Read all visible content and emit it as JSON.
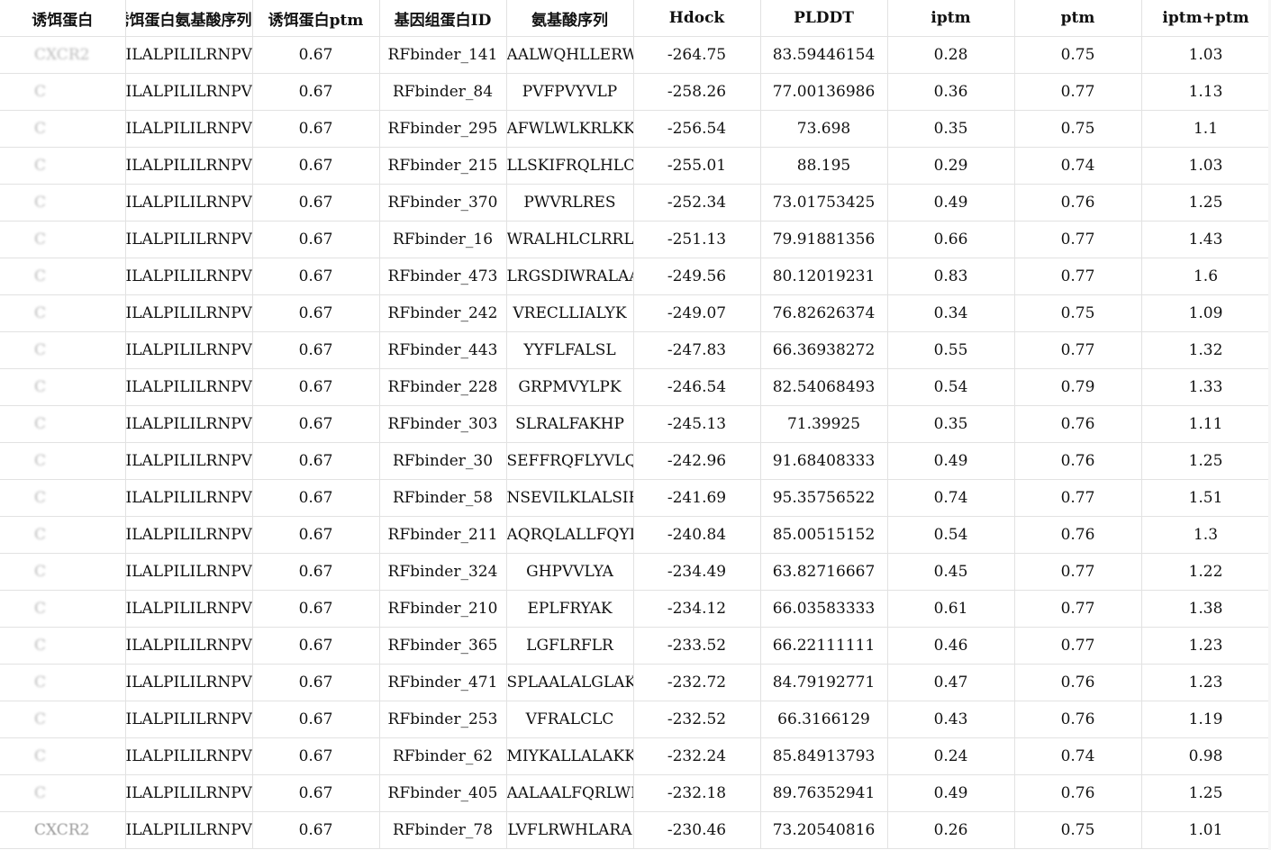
{
  "headers": [
    "诱饵蛋白",
    "诱饵蛋白氨基酸序列",
    "诱饵蛋白ptm",
    "基因组蛋白ID",
    "氨基酸序列",
    "Hdock",
    "PLDDT",
    "iptm",
    "ptm",
    "iptm+ptm"
  ],
  "rows": [
    [
      "CXCR2",
      "ILALPILILRNPVK",
      "0.67",
      "RFbinder_141",
      "AALWQHLLERW",
      "-264.75",
      "83.59446154",
      "0.28",
      "0.75",
      "1.03"
    ],
    [
      "C",
      "ILALPILILRNPVK",
      "0.67",
      "RFbinder_84",
      "PVFPVYVLP",
      "-258.26",
      "77.00136986",
      "0.36",
      "0.77",
      "1.13"
    ],
    [
      "C",
      "ILALPILILRNPVK",
      "0.67",
      "RFbinder_295",
      "AFWLWLKRLKKK",
      "-256.54",
      "73.698",
      "0.35",
      "0.75",
      "1.1"
    ],
    [
      "C",
      "ILALPILILRNPVK",
      "0.67",
      "RFbinder_215",
      "LLSKIFRQLHLCK",
      "-255.01",
      "88.195",
      "0.29",
      "0.74",
      "1.03"
    ],
    [
      "C",
      "ILALPILILRNPVK",
      "0.67",
      "RFbinder_370",
      "PWVRLRES",
      "-252.34",
      "73.01753425",
      "0.49",
      "0.76",
      "1.25"
    ],
    [
      "C",
      "ILALPILILRNPVK",
      "0.67",
      "RFbinder_16",
      "WRALHLCLRRLA",
      "-251.13",
      "79.91881356",
      "0.66",
      "0.77",
      "1.43"
    ],
    [
      "C",
      "ILALPILILRNPVK",
      "0.67",
      "RFbinder_473",
      "LRGSDIWRALAAF",
      "-249.56",
      "80.12019231",
      "0.83",
      "0.77",
      "1.6"
    ],
    [
      "C",
      "ILALPILILRNPVK",
      "0.67",
      "RFbinder_242",
      "VRECLLIALYK",
      "-249.07",
      "76.82626374",
      "0.34",
      "0.75",
      "1.09"
    ],
    [
      "C",
      "ILALPILILRNPVK",
      "0.67",
      "RFbinder_443",
      "YYFLFALSL",
      "-247.83",
      "66.36938272",
      "0.55",
      "0.77",
      "1.32"
    ],
    [
      "C",
      "ILALPILILRNPVK",
      "0.67",
      "RFbinder_228",
      "GRPMVYLPK",
      "-246.54",
      "82.54068493",
      "0.54",
      "0.79",
      "1.33"
    ],
    [
      "C",
      "ILALPILILRNPVK",
      "0.67",
      "RFbinder_303",
      "SLRALFAKHP",
      "-245.13",
      "71.39925",
      "0.35",
      "0.76",
      "1.11"
    ],
    [
      "C",
      "ILALPILILRNPVK",
      "0.67",
      "RFbinder_30",
      "SEFFRQFLYVLQL",
      "-242.96",
      "91.68408333",
      "0.49",
      "0.76",
      "1.25"
    ],
    [
      "C",
      "ILALPILILRNPVK",
      "0.67",
      "RFbinder_58",
      "NSEVILKLALSIFL",
      "-241.69",
      "95.35756522",
      "0.74",
      "0.77",
      "1.51"
    ],
    [
      "C",
      "ILALPILILRNPVK",
      "0.67",
      "RFbinder_211",
      "AQRQLALLFQYLV",
      "-240.84",
      "85.00515152",
      "0.54",
      "0.76",
      "1.3"
    ],
    [
      "C",
      "ILALPILILRNPVK",
      "0.67",
      "RFbinder_324",
      "GHPVVLYA",
      "-234.49",
      "63.82716667",
      "0.45",
      "0.77",
      "1.22"
    ],
    [
      "C",
      "ILALPILILRNPVK",
      "0.67",
      "RFbinder_210",
      "EPLFRYAK",
      "-234.12",
      "66.03583333",
      "0.61",
      "0.77",
      "1.38"
    ],
    [
      "C",
      "ILALPILILRNPVK",
      "0.67",
      "RFbinder_365",
      "LGFLRFLR",
      "-233.52",
      "66.22111111",
      "0.46",
      "0.77",
      "1.23"
    ],
    [
      "C",
      "ILALPILILRNPVK",
      "0.67",
      "RFbinder_471",
      "SPLAALALGLAKA",
      "-232.72",
      "84.79192771",
      "0.47",
      "0.76",
      "1.23"
    ],
    [
      "C",
      "ILALPILILRNPVK",
      "0.67",
      "RFbinder_253",
      "VFRALCLC",
      "-232.52",
      "66.3166129",
      "0.43",
      "0.76",
      "1.19"
    ],
    [
      "C",
      "ILALPILILRNPVK",
      "0.67",
      "RFbinder_62",
      "MIYKALLALAKKA",
      "-232.24",
      "85.84913793",
      "0.24",
      "0.74",
      "0.98"
    ],
    [
      "C",
      "ILALPILILRNPVK",
      "0.67",
      "RFbinder_405",
      "AALAALFQRLWD",
      "-232.18",
      "89.76352941",
      "0.49",
      "0.76",
      "1.25"
    ],
    [
      "CXCR2",
      "ILALPILILRNPVK",
      "0.67",
      "RFbinder_78",
      "LVFLRWHLARA",
      "-230.46",
      "73.20540816",
      "0.26",
      "0.75",
      "1.01"
    ]
  ]
}
